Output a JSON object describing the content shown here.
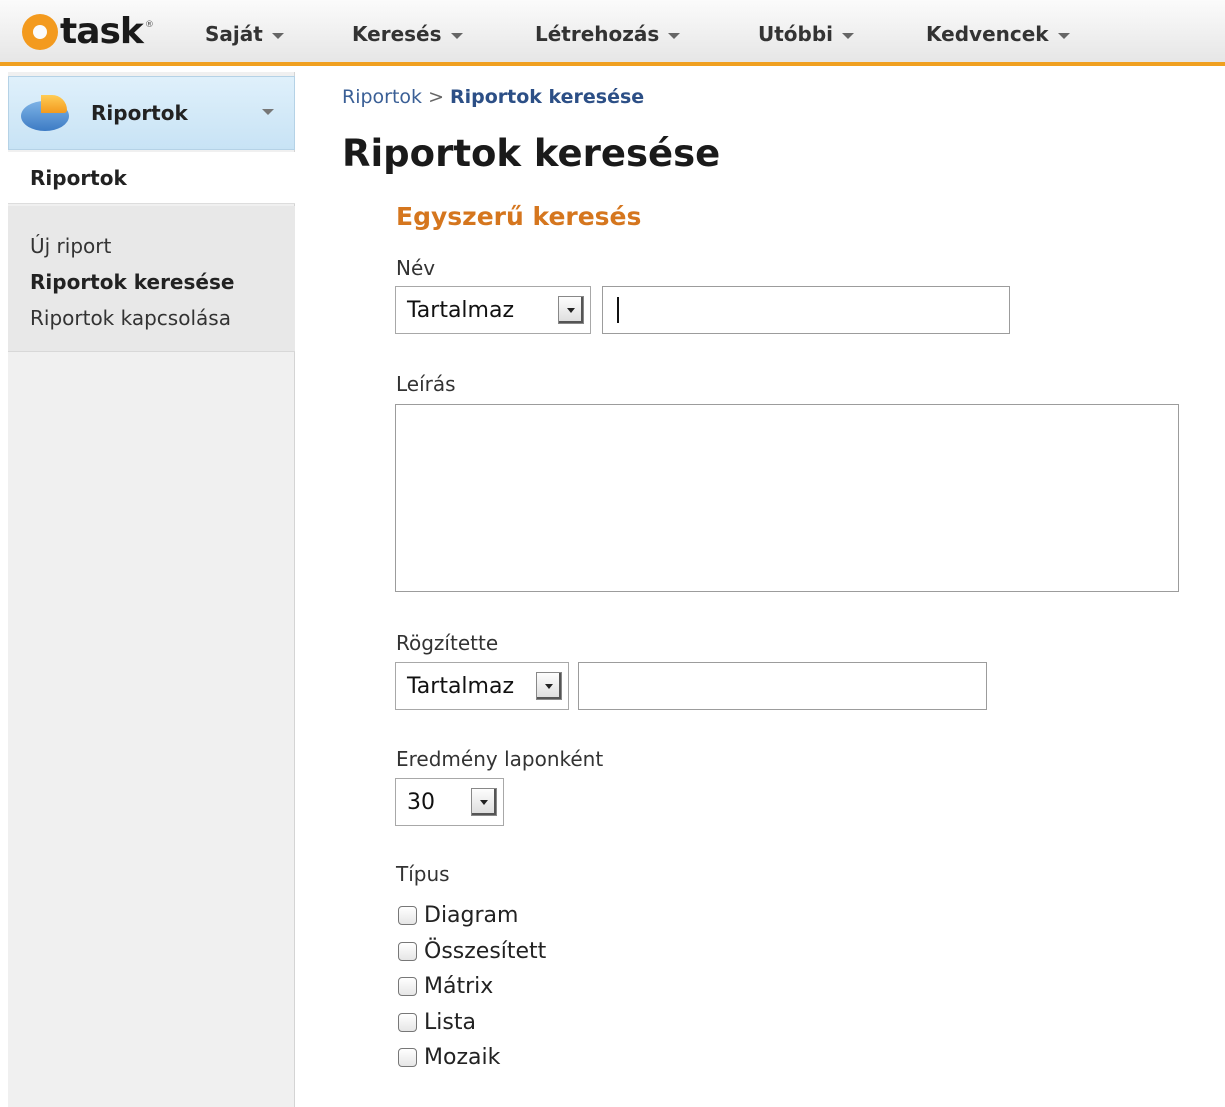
{
  "app": {
    "logo_text": "task",
    "logo_mark": "@",
    "logo_reg": "®"
  },
  "nav": [
    {
      "label": "Saját"
    },
    {
      "label": "Keresés"
    },
    {
      "label": "Létrehozás"
    },
    {
      "label": "Utóbbi"
    },
    {
      "label": "Kedvencek"
    }
  ],
  "sidebar": {
    "module": "Riportok",
    "section": "Riportok",
    "links": [
      {
        "label": "Új riport",
        "active": false
      },
      {
        "label": "Riportok keresése",
        "active": true
      },
      {
        "label": "Riportok kapcsolása",
        "active": false
      }
    ]
  },
  "breadcrumb": {
    "parent": "Riportok",
    "separator": ">",
    "current": "Riportok keresése"
  },
  "page": {
    "title": "Riportok keresése",
    "section": "Egyszerű keresés"
  },
  "form": {
    "name": {
      "label": "Név",
      "operator": "Tartalmaz",
      "value": ""
    },
    "description": {
      "label": "Leírás",
      "value": ""
    },
    "entered_by": {
      "label": "Rögzítette",
      "operator": "Tartalmaz",
      "value": ""
    },
    "per_page": {
      "label": "Eredmény laponként",
      "value": "30"
    },
    "type": {
      "label": "Típus",
      "options": [
        {
          "label": "Diagram",
          "checked": false
        },
        {
          "label": "Összesített",
          "checked": false
        },
        {
          "label": "Mátrix",
          "checked": false
        },
        {
          "label": "Lista",
          "checked": false
        },
        {
          "label": "Mozaik",
          "checked": false
        }
      ]
    }
  },
  "colors": {
    "accent": "#f0a020",
    "section_title": "#d5761e",
    "link": "#3a5f96"
  }
}
